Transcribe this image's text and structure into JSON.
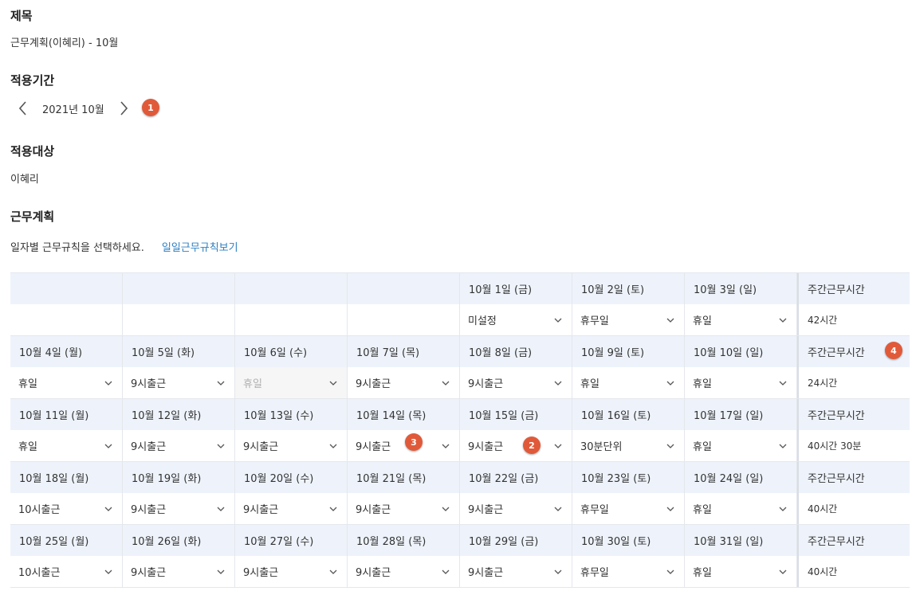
{
  "title_section": {
    "label": "제목",
    "value": "근무계획(이혜리) - 10월"
  },
  "period_section": {
    "label": "적용기간",
    "value": "2021년 10월"
  },
  "target_section": {
    "label": "적용대상",
    "value": "이혜리"
  },
  "plan_section": {
    "label": "근무계획",
    "instruction": "일자별 근무규칙을 선택하세요.",
    "link": "일일근무규칙보기"
  },
  "badges": [
    "1",
    "2",
    "3",
    "4"
  ],
  "weekly_header": "주간근무시간",
  "weeks": [
    {
      "days": [
        {
          "date": "",
          "rule": ""
        },
        {
          "date": "",
          "rule": ""
        },
        {
          "date": "",
          "rule": ""
        },
        {
          "date": "",
          "rule": ""
        },
        {
          "date": "10월 1일 (금)",
          "rule": "미설정"
        },
        {
          "date": "10월 2일 (토)",
          "rule": "휴무일"
        },
        {
          "date": "10월 3일 (일)",
          "rule": "휴일"
        }
      ],
      "total": "42시간"
    },
    {
      "days": [
        {
          "date": "10월 4일 (월)",
          "rule": "휴일"
        },
        {
          "date": "10월 5일 (화)",
          "rule": "9시출근"
        },
        {
          "date": "10월 6일 (수)",
          "rule": "휴일",
          "disabled": true
        },
        {
          "date": "10월 7일 (목)",
          "rule": "9시출근"
        },
        {
          "date": "10월 8일 (금)",
          "rule": "9시출근"
        },
        {
          "date": "10월 9일 (토)",
          "rule": "휴일"
        },
        {
          "date": "10월 10일 (일)",
          "rule": "휴일"
        }
      ],
      "total": "24시간"
    },
    {
      "days": [
        {
          "date": "10월 11일 (월)",
          "rule": "휴일"
        },
        {
          "date": "10월 12일 (화)",
          "rule": "9시출근"
        },
        {
          "date": "10월 13일 (수)",
          "rule": "9시출근"
        },
        {
          "date": "10월 14일 (목)",
          "rule": "9시출근"
        },
        {
          "date": "10월 15일 (금)",
          "rule": "9시출근"
        },
        {
          "date": "10월 16일 (토)",
          "rule": "30분단위"
        },
        {
          "date": "10월 17일 (일)",
          "rule": "휴일"
        }
      ],
      "total": "40시간 30분"
    },
    {
      "days": [
        {
          "date": "10월 18일 (월)",
          "rule": "10시출근"
        },
        {
          "date": "10월 19일 (화)",
          "rule": "9시출근"
        },
        {
          "date": "10월 20일 (수)",
          "rule": "9시출근"
        },
        {
          "date": "10월 21일 (목)",
          "rule": "9시출근"
        },
        {
          "date": "10월 22일 (금)",
          "rule": "9시출근"
        },
        {
          "date": "10월 23일 (토)",
          "rule": "휴무일"
        },
        {
          "date": "10월 24일 (일)",
          "rule": "휴일"
        }
      ],
      "total": "40시간"
    },
    {
      "days": [
        {
          "date": "10월 25일 (월)",
          "rule": "10시출근"
        },
        {
          "date": "10월 26일 (화)",
          "rule": "9시출근"
        },
        {
          "date": "10월 27일 (수)",
          "rule": "9시출근"
        },
        {
          "date": "10월 28일 (목)",
          "rule": "9시출근"
        },
        {
          "date": "10월 29일 (금)",
          "rule": "9시출근"
        },
        {
          "date": "10월 30일 (토)",
          "rule": "휴무일"
        },
        {
          "date": "10월 31일 (일)",
          "rule": "휴일"
        }
      ],
      "total": "40시간"
    }
  ],
  "colors": {
    "header_bg": "#eef3fb",
    "link": "#2d7fc1",
    "badge": "#e05a3a"
  }
}
